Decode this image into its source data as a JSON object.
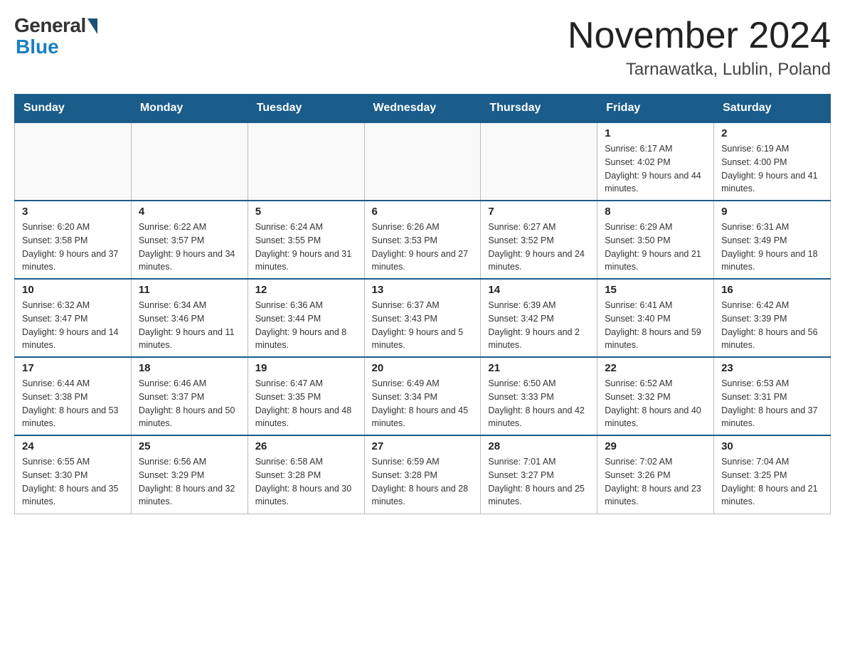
{
  "header": {
    "logo_general": "General",
    "logo_blue": "Blue",
    "month_title": "November 2024",
    "location": "Tarnawatka, Lublin, Poland"
  },
  "weekdays": [
    "Sunday",
    "Monday",
    "Tuesday",
    "Wednesday",
    "Thursday",
    "Friday",
    "Saturday"
  ],
  "weeks": [
    [
      {
        "day": "",
        "info": ""
      },
      {
        "day": "",
        "info": ""
      },
      {
        "day": "",
        "info": ""
      },
      {
        "day": "",
        "info": ""
      },
      {
        "day": "",
        "info": ""
      },
      {
        "day": "1",
        "info": "Sunrise: 6:17 AM\nSunset: 4:02 PM\nDaylight: 9 hours and 44 minutes."
      },
      {
        "day": "2",
        "info": "Sunrise: 6:19 AM\nSunset: 4:00 PM\nDaylight: 9 hours and 41 minutes."
      }
    ],
    [
      {
        "day": "3",
        "info": "Sunrise: 6:20 AM\nSunset: 3:58 PM\nDaylight: 9 hours and 37 minutes."
      },
      {
        "day": "4",
        "info": "Sunrise: 6:22 AM\nSunset: 3:57 PM\nDaylight: 9 hours and 34 minutes."
      },
      {
        "day": "5",
        "info": "Sunrise: 6:24 AM\nSunset: 3:55 PM\nDaylight: 9 hours and 31 minutes."
      },
      {
        "day": "6",
        "info": "Sunrise: 6:26 AM\nSunset: 3:53 PM\nDaylight: 9 hours and 27 minutes."
      },
      {
        "day": "7",
        "info": "Sunrise: 6:27 AM\nSunset: 3:52 PM\nDaylight: 9 hours and 24 minutes."
      },
      {
        "day": "8",
        "info": "Sunrise: 6:29 AM\nSunset: 3:50 PM\nDaylight: 9 hours and 21 minutes."
      },
      {
        "day": "9",
        "info": "Sunrise: 6:31 AM\nSunset: 3:49 PM\nDaylight: 9 hours and 18 minutes."
      }
    ],
    [
      {
        "day": "10",
        "info": "Sunrise: 6:32 AM\nSunset: 3:47 PM\nDaylight: 9 hours and 14 minutes."
      },
      {
        "day": "11",
        "info": "Sunrise: 6:34 AM\nSunset: 3:46 PM\nDaylight: 9 hours and 11 minutes."
      },
      {
        "day": "12",
        "info": "Sunrise: 6:36 AM\nSunset: 3:44 PM\nDaylight: 9 hours and 8 minutes."
      },
      {
        "day": "13",
        "info": "Sunrise: 6:37 AM\nSunset: 3:43 PM\nDaylight: 9 hours and 5 minutes."
      },
      {
        "day": "14",
        "info": "Sunrise: 6:39 AM\nSunset: 3:42 PM\nDaylight: 9 hours and 2 minutes."
      },
      {
        "day": "15",
        "info": "Sunrise: 6:41 AM\nSunset: 3:40 PM\nDaylight: 8 hours and 59 minutes."
      },
      {
        "day": "16",
        "info": "Sunrise: 6:42 AM\nSunset: 3:39 PM\nDaylight: 8 hours and 56 minutes."
      }
    ],
    [
      {
        "day": "17",
        "info": "Sunrise: 6:44 AM\nSunset: 3:38 PM\nDaylight: 8 hours and 53 minutes."
      },
      {
        "day": "18",
        "info": "Sunrise: 6:46 AM\nSunset: 3:37 PM\nDaylight: 8 hours and 50 minutes."
      },
      {
        "day": "19",
        "info": "Sunrise: 6:47 AM\nSunset: 3:35 PM\nDaylight: 8 hours and 48 minutes."
      },
      {
        "day": "20",
        "info": "Sunrise: 6:49 AM\nSunset: 3:34 PM\nDaylight: 8 hours and 45 minutes."
      },
      {
        "day": "21",
        "info": "Sunrise: 6:50 AM\nSunset: 3:33 PM\nDaylight: 8 hours and 42 minutes."
      },
      {
        "day": "22",
        "info": "Sunrise: 6:52 AM\nSunset: 3:32 PM\nDaylight: 8 hours and 40 minutes."
      },
      {
        "day": "23",
        "info": "Sunrise: 6:53 AM\nSunset: 3:31 PM\nDaylight: 8 hours and 37 minutes."
      }
    ],
    [
      {
        "day": "24",
        "info": "Sunrise: 6:55 AM\nSunset: 3:30 PM\nDaylight: 8 hours and 35 minutes."
      },
      {
        "day": "25",
        "info": "Sunrise: 6:56 AM\nSunset: 3:29 PM\nDaylight: 8 hours and 32 minutes."
      },
      {
        "day": "26",
        "info": "Sunrise: 6:58 AM\nSunset: 3:28 PM\nDaylight: 8 hours and 30 minutes."
      },
      {
        "day": "27",
        "info": "Sunrise: 6:59 AM\nSunset: 3:28 PM\nDaylight: 8 hours and 28 minutes."
      },
      {
        "day": "28",
        "info": "Sunrise: 7:01 AM\nSunset: 3:27 PM\nDaylight: 8 hours and 25 minutes."
      },
      {
        "day": "29",
        "info": "Sunrise: 7:02 AM\nSunset: 3:26 PM\nDaylight: 8 hours and 23 minutes."
      },
      {
        "day": "30",
        "info": "Sunrise: 7:04 AM\nSunset: 3:25 PM\nDaylight: 8 hours and 21 minutes."
      }
    ]
  ]
}
